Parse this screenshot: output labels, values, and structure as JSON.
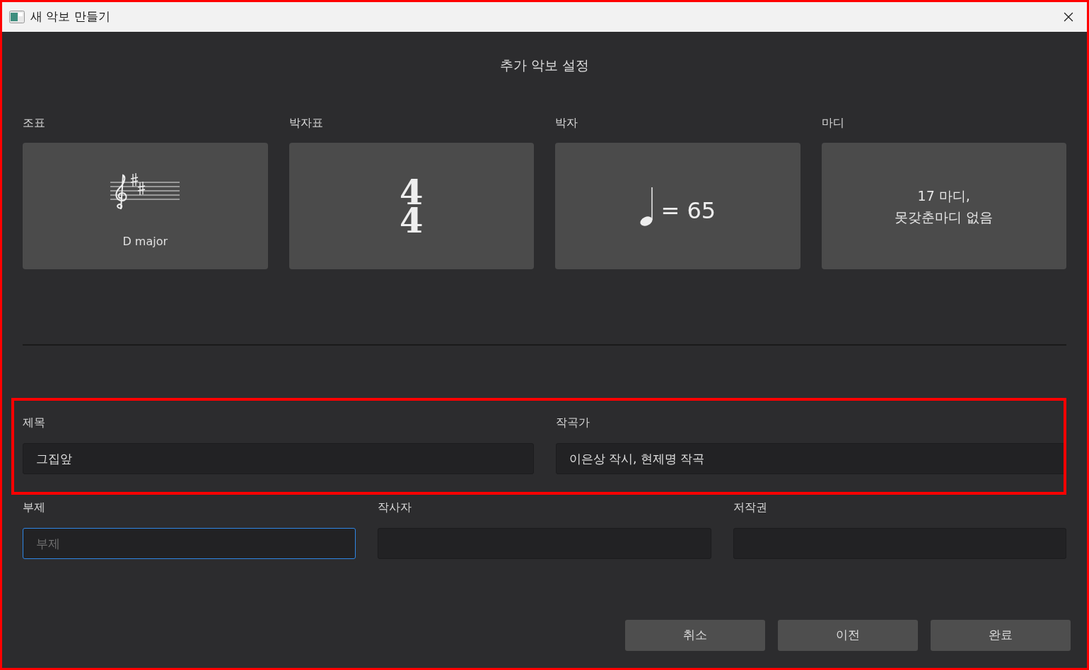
{
  "window": {
    "title": "새 악보 만들기"
  },
  "heading": "추가 악보 설정",
  "cards": [
    {
      "kind": "key",
      "label": "조표",
      "caption": "D major"
    },
    {
      "kind": "time",
      "label": "박자표",
      "numerator": "4",
      "denominator": "4"
    },
    {
      "kind": "tempo",
      "label": "박자",
      "text": "= 65"
    },
    {
      "kind": "measures",
      "label": "마디",
      "lines": [
        "17 마디,",
        "못갖춘마디 없음"
      ]
    }
  ],
  "fields_primary": [
    {
      "label": "제목",
      "value": "그집앞",
      "focused": false
    },
    {
      "label": "작곡가",
      "value": "이은상 작시, 현제명 작곡",
      "focused": false
    }
  ],
  "fields_secondary": [
    {
      "label": "부제",
      "placeholder": "부제",
      "focused": true
    },
    {
      "label": "작사자",
      "focused": false
    },
    {
      "label": "저작권",
      "focused": false
    }
  ],
  "buttons": [
    "취소",
    "이전",
    "완료"
  ]
}
